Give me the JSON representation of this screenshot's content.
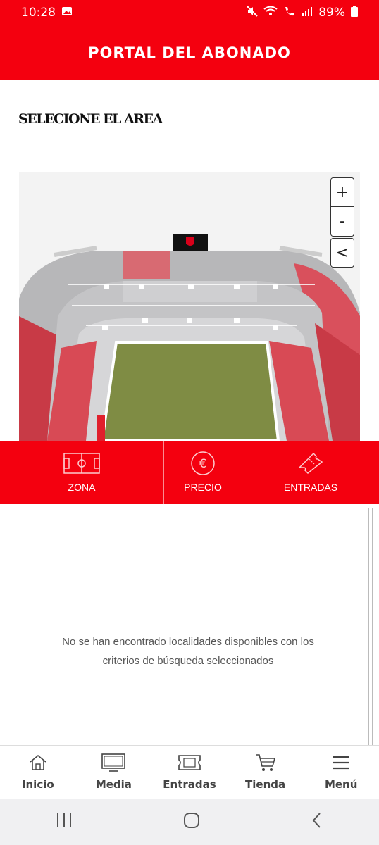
{
  "status_bar": {
    "time": "10:28",
    "battery": "89%",
    "icons": [
      "image-icon",
      "mute-icon",
      "wifi-icon",
      "call-icon",
      "signal-icon",
      "battery-icon"
    ]
  },
  "header": {
    "title": "PORTAL DEL ABONADO"
  },
  "section": {
    "title": "SELECIONE EL AREA"
  },
  "map": {
    "zoom_in_label": "+",
    "zoom_out_label": "-",
    "back_label": "<"
  },
  "filters": [
    {
      "label": "ZONA",
      "icon": "field-icon"
    },
    {
      "label": "PRECIO",
      "icon": "euro-icon"
    },
    {
      "label": "ENTRADAS",
      "icon": "ticket-icon"
    }
  ],
  "results": {
    "empty_line1": "No se han encontrado localidades disponibles con los",
    "empty_line2": "criterios de búsqueda seleccionados"
  },
  "bottom_nav": [
    {
      "label": "Inicio",
      "icon": "home-icon"
    },
    {
      "label": "Media",
      "icon": "tv-icon"
    },
    {
      "label": "Entradas",
      "icon": "ticket-icon"
    },
    {
      "label": "Tienda",
      "icon": "cart-icon"
    },
    {
      "label": "Menú",
      "icon": "menu-icon"
    }
  ],
  "system_nav": [
    "recents-icon",
    "home-circle-icon",
    "back-icon"
  ],
  "colors": {
    "brand_red": "#f4000f",
    "text_gray": "#555555"
  }
}
